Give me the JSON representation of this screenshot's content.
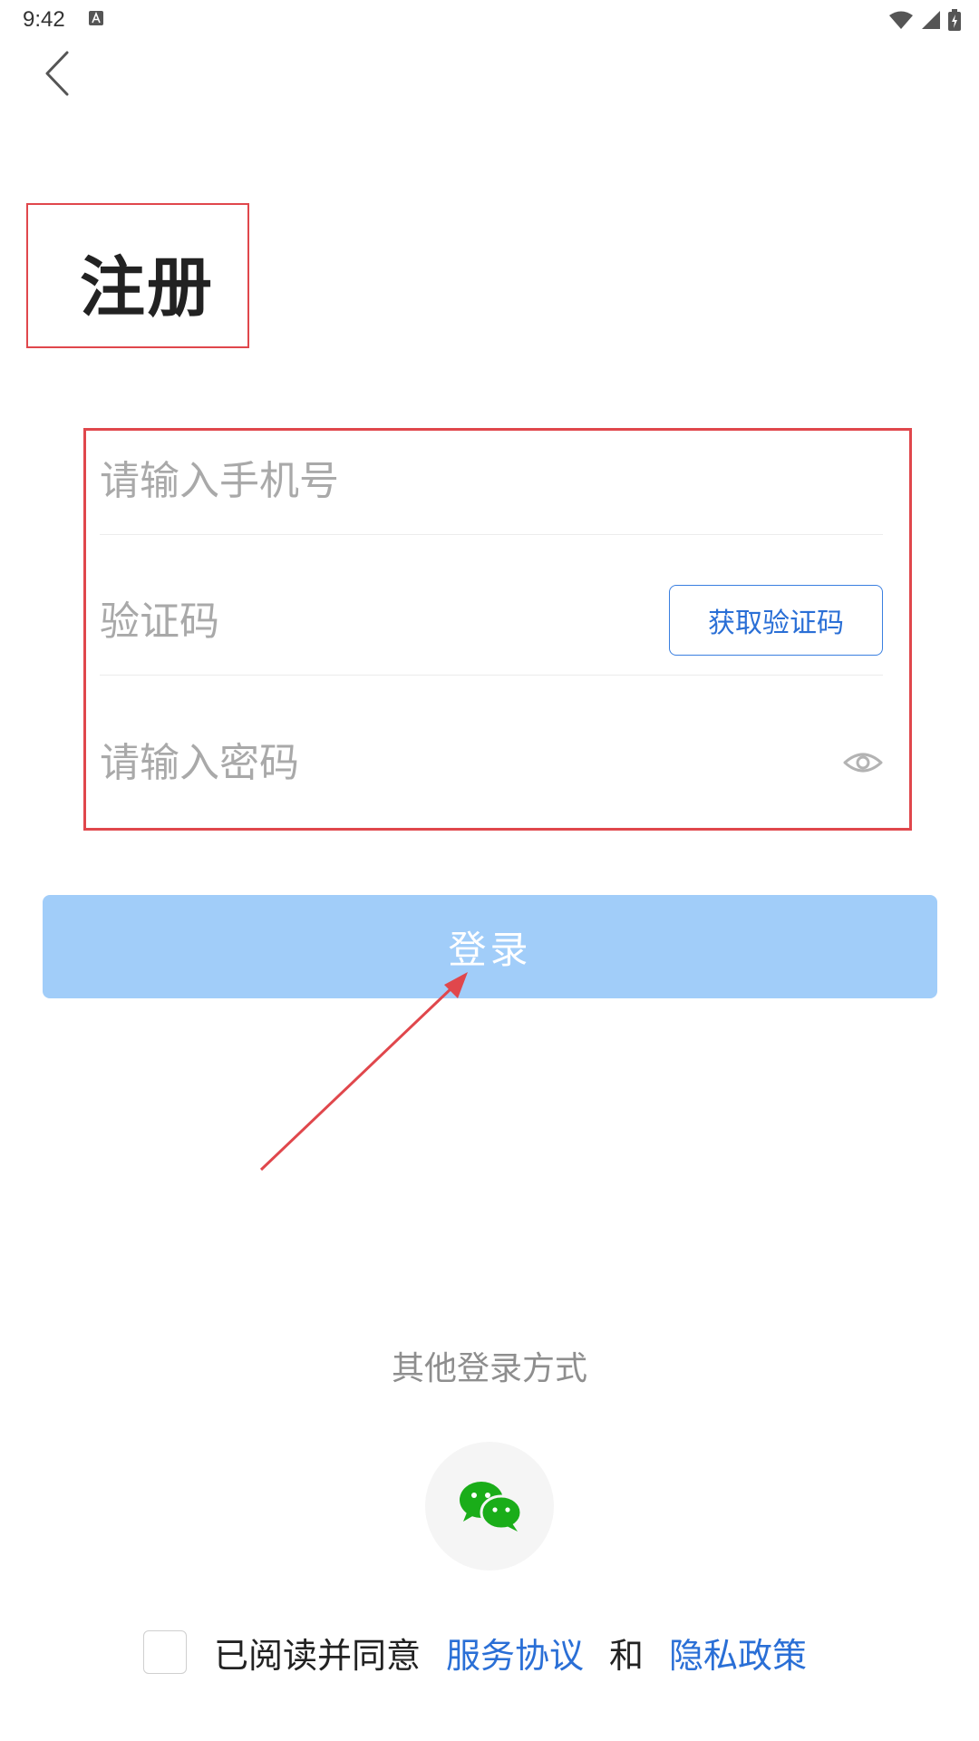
{
  "status_bar": {
    "time": "9:42"
  },
  "header": {
    "back_icon": "chevron-left-icon"
  },
  "page": {
    "title": "注册"
  },
  "form": {
    "phone_placeholder": "请输入手机号",
    "code_placeholder": "验证码",
    "get_code_label": "获取验证码",
    "password_placeholder": "请输入密码",
    "password_toggle_icon": "eye-icon"
  },
  "login": {
    "label": "登录"
  },
  "other_login": {
    "label": "其他登录方式",
    "wechat_icon": "wechat-icon"
  },
  "agreement": {
    "prefix": "已阅读并同意",
    "service_link": "服务协议",
    "and": "和",
    "privacy_link": "隐私政策"
  },
  "colors": {
    "accent": "#2a6fd6",
    "login_button": "#a1cdf9",
    "annotation": "#e0474c",
    "wechat_green": "#1aad19"
  }
}
